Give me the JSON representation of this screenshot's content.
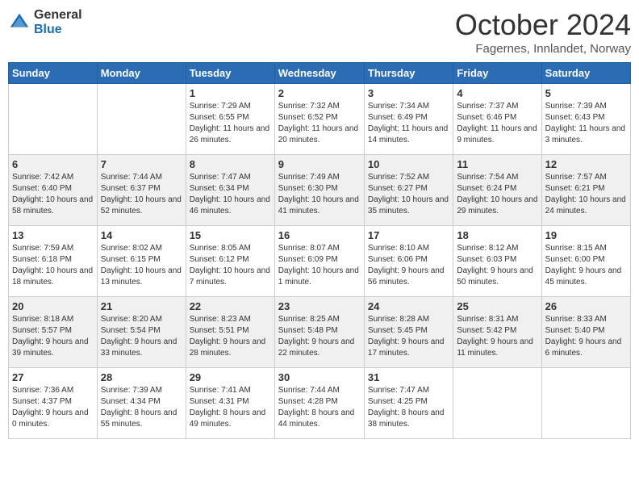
{
  "header": {
    "logo_general": "General",
    "logo_blue": "Blue",
    "title": "October 2024",
    "location": "Fagernes, Innlandet, Norway"
  },
  "weekdays": [
    "Sunday",
    "Monday",
    "Tuesday",
    "Wednesday",
    "Thursday",
    "Friday",
    "Saturday"
  ],
  "weeks": [
    [
      {
        "day": "",
        "info": ""
      },
      {
        "day": "",
        "info": ""
      },
      {
        "day": "1",
        "info": "Sunrise: 7:29 AM\nSunset: 6:55 PM\nDaylight: 11 hours and 26 minutes."
      },
      {
        "day": "2",
        "info": "Sunrise: 7:32 AM\nSunset: 6:52 PM\nDaylight: 11 hours and 20 minutes."
      },
      {
        "day": "3",
        "info": "Sunrise: 7:34 AM\nSunset: 6:49 PM\nDaylight: 11 hours and 14 minutes."
      },
      {
        "day": "4",
        "info": "Sunrise: 7:37 AM\nSunset: 6:46 PM\nDaylight: 11 hours and 9 minutes."
      },
      {
        "day": "5",
        "info": "Sunrise: 7:39 AM\nSunset: 6:43 PM\nDaylight: 11 hours and 3 minutes."
      }
    ],
    [
      {
        "day": "6",
        "info": "Sunrise: 7:42 AM\nSunset: 6:40 PM\nDaylight: 10 hours and 58 minutes."
      },
      {
        "day": "7",
        "info": "Sunrise: 7:44 AM\nSunset: 6:37 PM\nDaylight: 10 hours and 52 minutes."
      },
      {
        "day": "8",
        "info": "Sunrise: 7:47 AM\nSunset: 6:34 PM\nDaylight: 10 hours and 46 minutes."
      },
      {
        "day": "9",
        "info": "Sunrise: 7:49 AM\nSunset: 6:30 PM\nDaylight: 10 hours and 41 minutes."
      },
      {
        "day": "10",
        "info": "Sunrise: 7:52 AM\nSunset: 6:27 PM\nDaylight: 10 hours and 35 minutes."
      },
      {
        "day": "11",
        "info": "Sunrise: 7:54 AM\nSunset: 6:24 PM\nDaylight: 10 hours and 29 minutes."
      },
      {
        "day": "12",
        "info": "Sunrise: 7:57 AM\nSunset: 6:21 PM\nDaylight: 10 hours and 24 minutes."
      }
    ],
    [
      {
        "day": "13",
        "info": "Sunrise: 7:59 AM\nSunset: 6:18 PM\nDaylight: 10 hours and 18 minutes."
      },
      {
        "day": "14",
        "info": "Sunrise: 8:02 AM\nSunset: 6:15 PM\nDaylight: 10 hours and 13 minutes."
      },
      {
        "day": "15",
        "info": "Sunrise: 8:05 AM\nSunset: 6:12 PM\nDaylight: 10 hours and 7 minutes."
      },
      {
        "day": "16",
        "info": "Sunrise: 8:07 AM\nSunset: 6:09 PM\nDaylight: 10 hours and 1 minute."
      },
      {
        "day": "17",
        "info": "Sunrise: 8:10 AM\nSunset: 6:06 PM\nDaylight: 9 hours and 56 minutes."
      },
      {
        "day": "18",
        "info": "Sunrise: 8:12 AM\nSunset: 6:03 PM\nDaylight: 9 hours and 50 minutes."
      },
      {
        "day": "19",
        "info": "Sunrise: 8:15 AM\nSunset: 6:00 PM\nDaylight: 9 hours and 45 minutes."
      }
    ],
    [
      {
        "day": "20",
        "info": "Sunrise: 8:18 AM\nSunset: 5:57 PM\nDaylight: 9 hours and 39 minutes."
      },
      {
        "day": "21",
        "info": "Sunrise: 8:20 AM\nSunset: 5:54 PM\nDaylight: 9 hours and 33 minutes."
      },
      {
        "day": "22",
        "info": "Sunrise: 8:23 AM\nSunset: 5:51 PM\nDaylight: 9 hours and 28 minutes."
      },
      {
        "day": "23",
        "info": "Sunrise: 8:25 AM\nSunset: 5:48 PM\nDaylight: 9 hours and 22 minutes."
      },
      {
        "day": "24",
        "info": "Sunrise: 8:28 AM\nSunset: 5:45 PM\nDaylight: 9 hours and 17 minutes."
      },
      {
        "day": "25",
        "info": "Sunrise: 8:31 AM\nSunset: 5:42 PM\nDaylight: 9 hours and 11 minutes."
      },
      {
        "day": "26",
        "info": "Sunrise: 8:33 AM\nSunset: 5:40 PM\nDaylight: 9 hours and 6 minutes."
      }
    ],
    [
      {
        "day": "27",
        "info": "Sunrise: 7:36 AM\nSunset: 4:37 PM\nDaylight: 9 hours and 0 minutes."
      },
      {
        "day": "28",
        "info": "Sunrise: 7:39 AM\nSunset: 4:34 PM\nDaylight: 8 hours and 55 minutes."
      },
      {
        "day": "29",
        "info": "Sunrise: 7:41 AM\nSunset: 4:31 PM\nDaylight: 8 hours and 49 minutes."
      },
      {
        "day": "30",
        "info": "Sunrise: 7:44 AM\nSunset: 4:28 PM\nDaylight: 8 hours and 44 minutes."
      },
      {
        "day": "31",
        "info": "Sunrise: 7:47 AM\nSunset: 4:25 PM\nDaylight: 8 hours and 38 minutes."
      },
      {
        "day": "",
        "info": ""
      },
      {
        "day": "",
        "info": ""
      }
    ]
  ]
}
